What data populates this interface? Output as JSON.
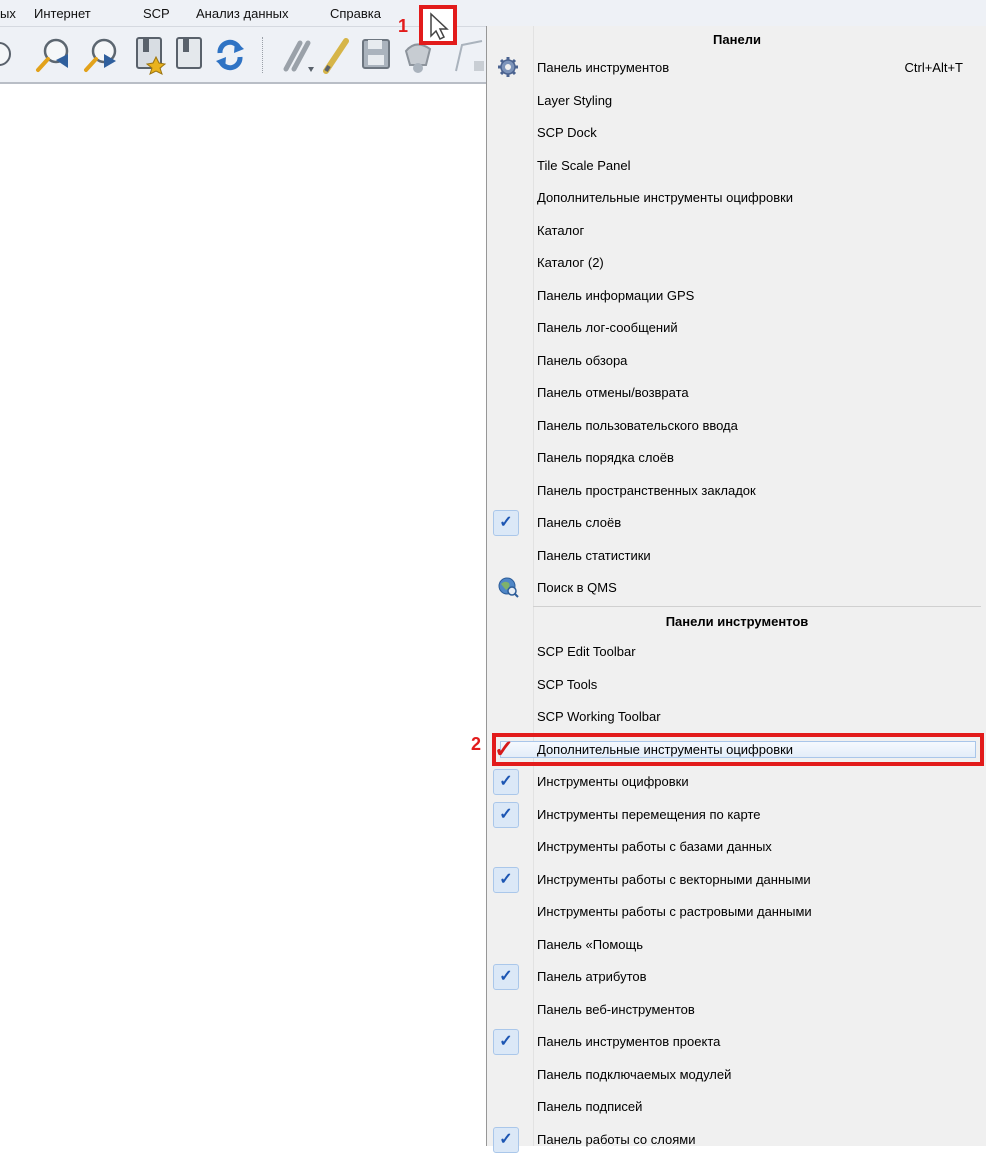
{
  "menubar": {
    "items": [
      "ых",
      "Интернет",
      "SCP",
      "Анализ данных",
      "Справка"
    ]
  },
  "annotations": {
    "marker1": "1",
    "marker2": "2"
  },
  "menu": {
    "panels_header": "Панели",
    "panels": [
      {
        "label": "Панель инструментов",
        "shortcut": "Ctrl+Alt+T",
        "icon": "gear-icon"
      },
      {
        "label": "Layer Styling"
      },
      {
        "label": "SCP Dock"
      },
      {
        "label": "Tile Scale Panel"
      },
      {
        "label": "Дополнительные инструменты оцифровки"
      },
      {
        "label": "Каталог"
      },
      {
        "label": "Каталог (2)"
      },
      {
        "label": "Панель информации GPS"
      },
      {
        "label": "Панель лог-сообщений"
      },
      {
        "label": "Панель обзора"
      },
      {
        "label": "Панель отмены/возврата"
      },
      {
        "label": "Панель пользовательского ввода"
      },
      {
        "label": "Панель порядка слоёв"
      },
      {
        "label": "Панель пространственных закладок"
      },
      {
        "label": "Панель слоёв",
        "checked": true
      },
      {
        "label": "Панель статистики"
      },
      {
        "label": "Поиск в QMS",
        "icon": "globe-search-icon"
      }
    ],
    "toolbars_header": "Панели инструментов",
    "toolbars": [
      {
        "label": "SCP Edit Toolbar"
      },
      {
        "label": "SCP Tools"
      },
      {
        "label": "SCP Working Toolbar"
      },
      {
        "label": "Дополнительные инструменты оцифровки",
        "checked": true,
        "highlighted": true
      },
      {
        "label": "Инструменты оцифровки",
        "checked": true
      },
      {
        "label": "Инструменты перемещения по карте",
        "checked": true
      },
      {
        "label": "Инструменты работы с базами данных"
      },
      {
        "label": "Инструменты работы с векторными данными",
        "checked": true
      },
      {
        "label": "Инструменты работы с растровыми данными"
      },
      {
        "label": "Панель «Помощь"
      },
      {
        "label": "Панель атрибутов",
        "checked": true
      },
      {
        "label": "Панель веб-инструментов"
      },
      {
        "label": "Панель инструментов проекта",
        "checked": true
      },
      {
        "label": "Панель подключаемых модулей"
      },
      {
        "label": "Панель подписей"
      },
      {
        "label": "Панель работы со слоями",
        "checked": true
      }
    ]
  },
  "colors": {
    "annotation_red": "#e21b1b",
    "check_blue": "#1d56b3",
    "menu_bg": "#f0f0f0",
    "toolbar_bg": "#eef1f6"
  }
}
